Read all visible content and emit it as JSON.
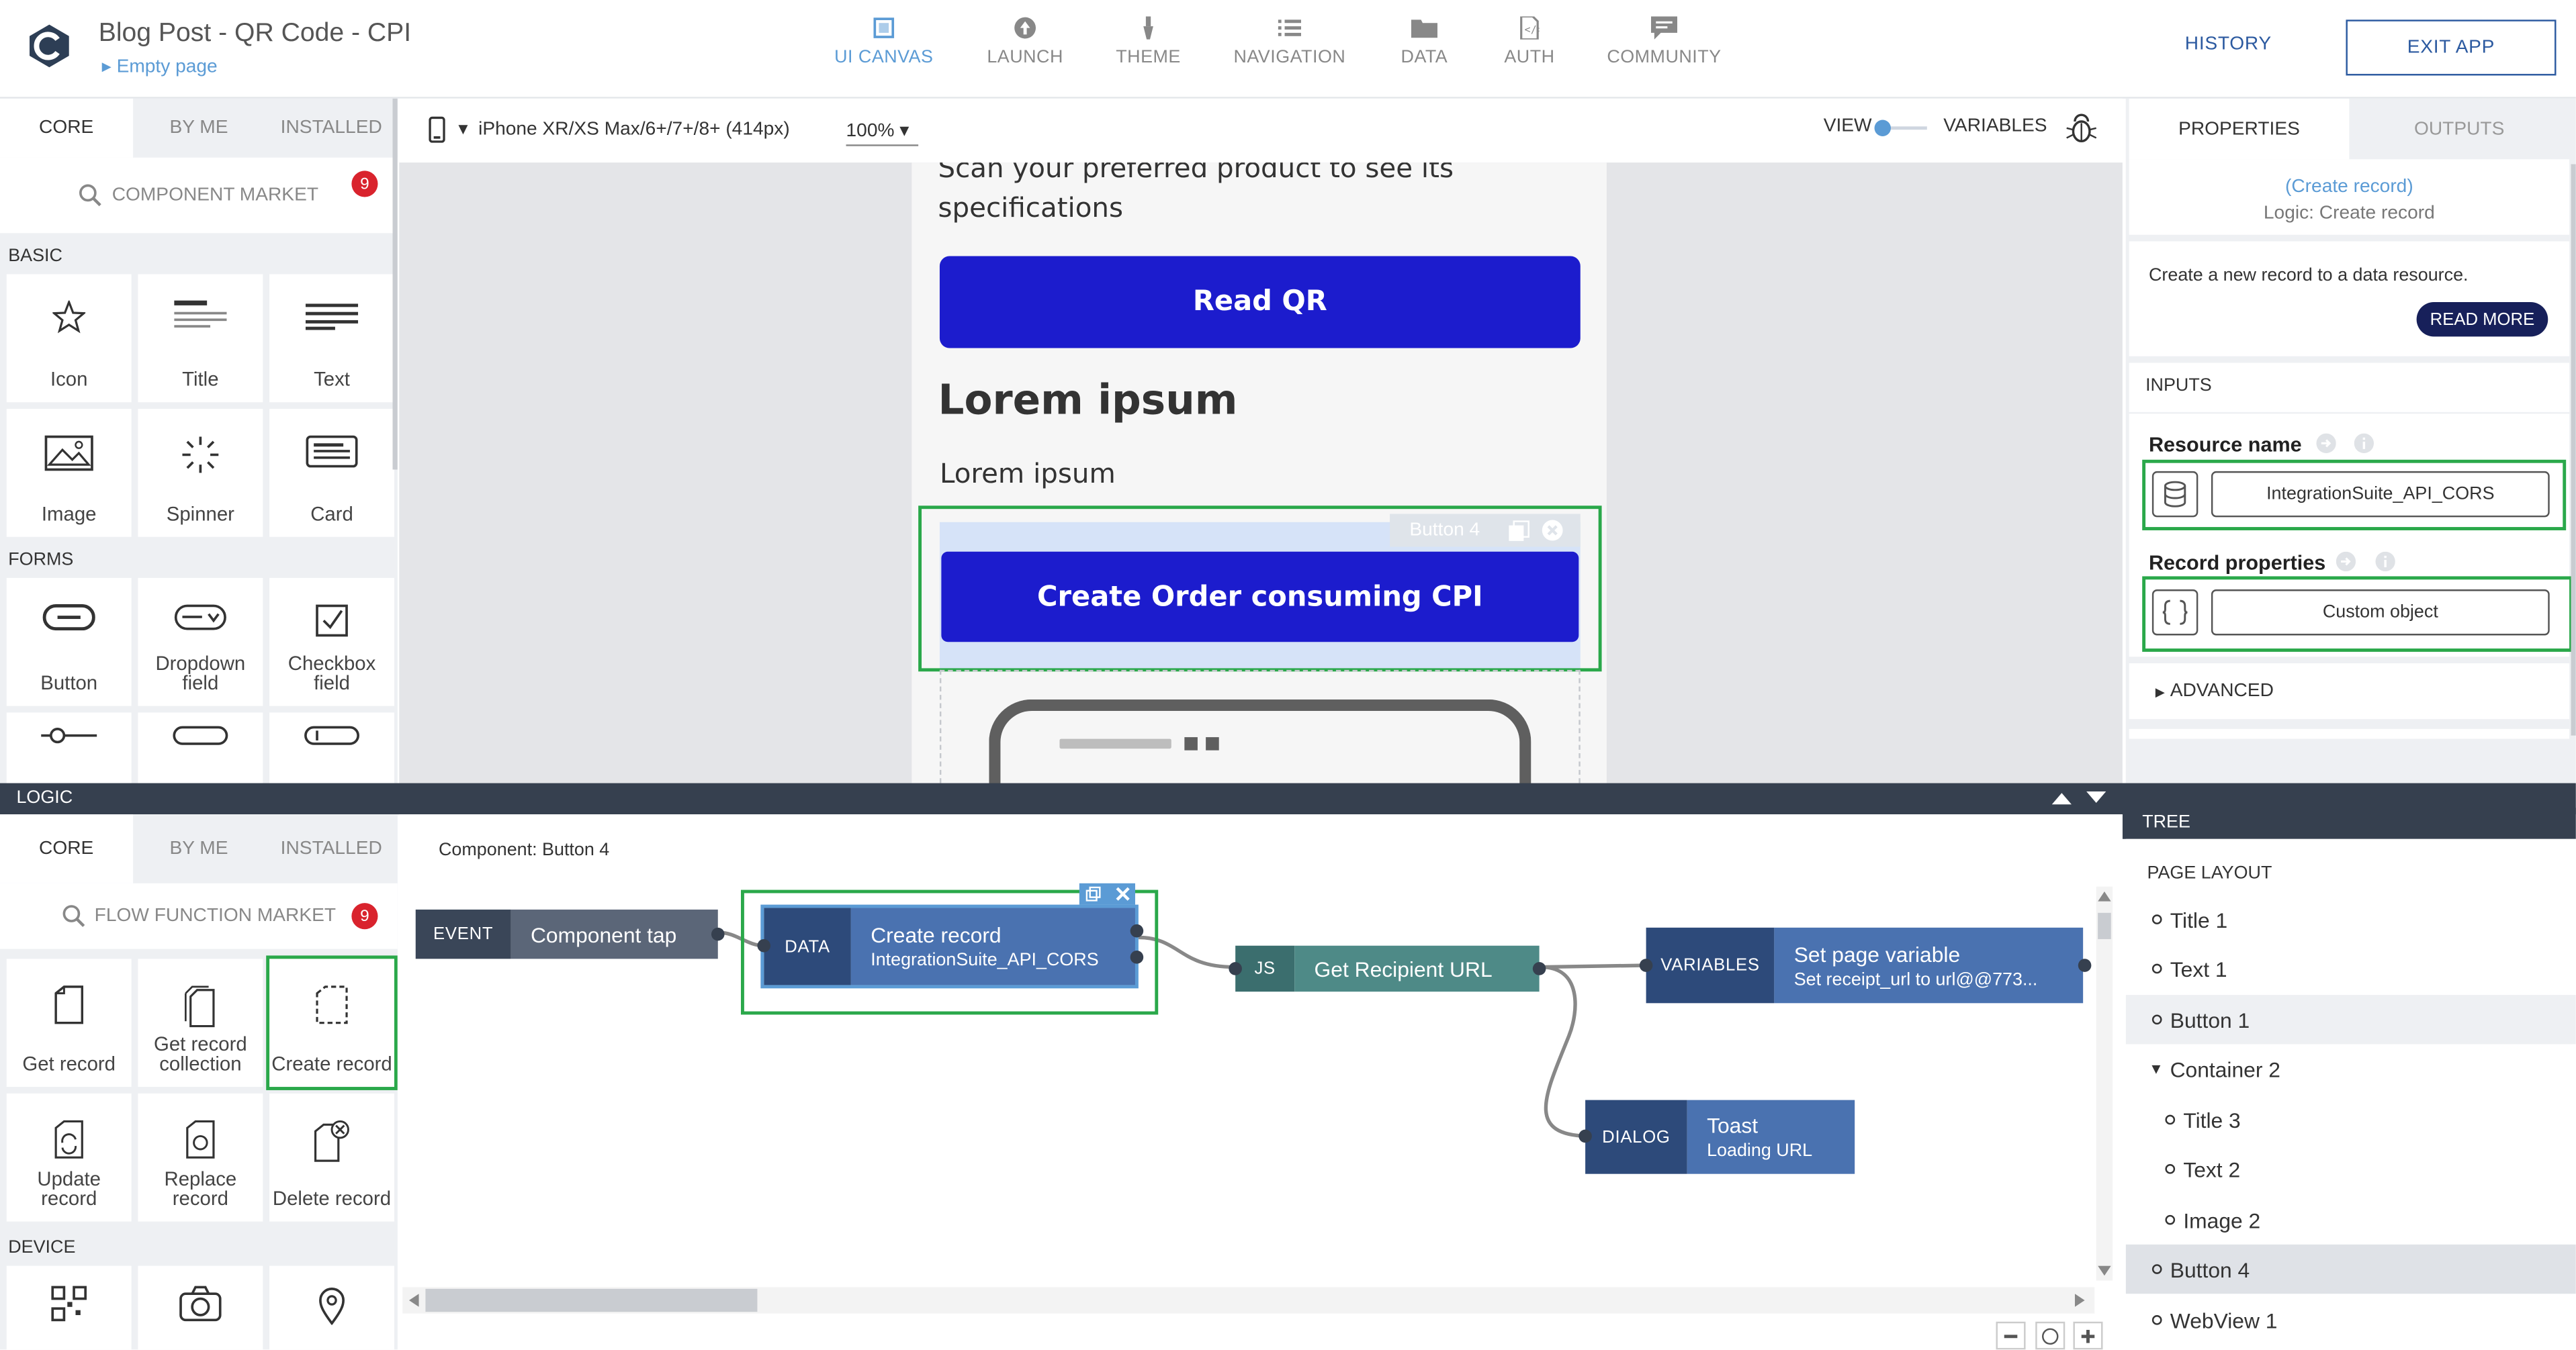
{
  "app": {
    "title": "Blog Post - QR Code - CPI",
    "page_selector": "Empty page"
  },
  "nav": [
    {
      "label": "UI CANVAS",
      "icon": "ui-canvas-icon"
    },
    {
      "label": "LAUNCH",
      "icon": "launch-icon"
    },
    {
      "label": "THEME",
      "icon": "theme-icon"
    },
    {
      "label": "NAVIGATION",
      "icon": "navigation-icon"
    },
    {
      "label": "DATA",
      "icon": "data-icon"
    },
    {
      "label": "AUTH",
      "icon": "auth-icon"
    },
    {
      "label": "COMMUNITY",
      "icon": "community-icon"
    }
  ],
  "header_actions": {
    "history": "HISTORY",
    "exit": "EXIT APP"
  },
  "left_panel": {
    "tabs": [
      "CORE",
      "BY ME",
      "INSTALLED"
    ],
    "search": "COMPONENT MARKET",
    "badge": "9",
    "sections": {
      "basic": "BASIC",
      "forms": "FORMS"
    },
    "basic_items": [
      "Icon",
      "Title",
      "Text",
      "Image",
      "Spinner",
      "Card"
    ],
    "form_items": [
      "Button",
      "Dropdown field",
      "Checkbox field"
    ]
  },
  "canvas_toolbar": {
    "device": "iPhone XR/XS Max/6+/7+/8+ (414px)",
    "zoom": "100%",
    "view": "VIEW",
    "variables": "VARIABLES"
  },
  "phone": {
    "intro": "Scan your preferred product to see its specifications",
    "read_qr": "Read QR",
    "heading": "Lorem ipsum",
    "body": "Lorem ipsum",
    "selected_label": "Button 4",
    "create_button": "Create Order consuming CPI"
  },
  "properties": {
    "tabs": [
      "PROPERTIES",
      "OUTPUTS"
    ],
    "link": "(Create record)",
    "subtitle": "Logic: Create record",
    "description": "Create a new record to a data resource.",
    "read_more": "READ MORE",
    "inputs_label": "INPUTS",
    "resource_label": "Resource name",
    "resource_value": "IntegrationSuite_API_CORS",
    "record_label": "Record properties",
    "record_value": "Custom object",
    "advanced": "ADVANCED"
  },
  "logic_bar": {
    "title": "LOGIC"
  },
  "logic_panel": {
    "tabs": [
      "CORE",
      "BY ME",
      "INSTALLED"
    ],
    "search": "FLOW FUNCTION MARKET",
    "badge": "9",
    "items": [
      "Get record",
      "Get record collection",
      "Create record",
      "Update record",
      "Replace record",
      "Delete record"
    ],
    "device_section": "DEVICE"
  },
  "flow": {
    "component_label": "Component: Button 4",
    "nodes": {
      "event": {
        "type": "EVENT",
        "title": "Component tap"
      },
      "data": {
        "type": "DATA",
        "title": "Create record",
        "sub": "IntegrationSuite_API_CORS"
      },
      "js": {
        "type": "JS",
        "title": "Get Recipient URL"
      },
      "variables": {
        "type": "VARIABLES",
        "title": "Set page variable",
        "sub": "Set receipt_url to url@@773..."
      },
      "dialog": {
        "type": "DIALOG",
        "title": "Toast",
        "sub": "Loading URL"
      }
    }
  },
  "tree": {
    "header": "TREE",
    "section": "PAGE LAYOUT",
    "items": [
      "Title 1",
      "Text 1",
      "Button 1",
      "Container 2",
      "Title 3",
      "Text 2",
      "Image 2",
      "Button 4",
      "WebView 1"
    ]
  },
  "colors": {
    "accent": "#5b9bd5",
    "primary_button": "#1c1ccd",
    "node_dark": "#2d4a7a",
    "node_light": "#4a72b0",
    "js_dark": "#3b6e6e",
    "js_light": "#4e8a87",
    "highlight": "#2aa84a"
  }
}
